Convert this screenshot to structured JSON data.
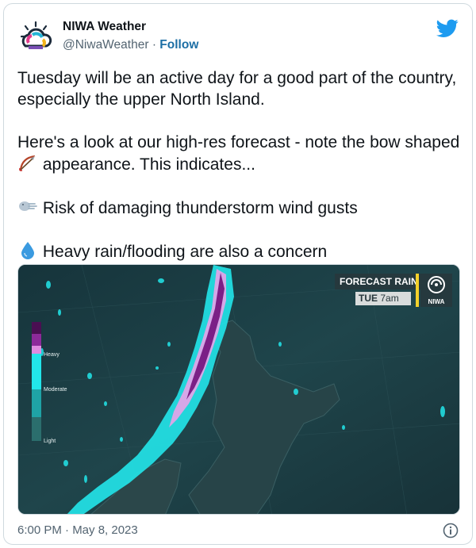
{
  "account": {
    "display_name": "NIWA Weather",
    "handle": "@NiwaWeather",
    "separator": "·",
    "follow_label": "Follow"
  },
  "tweet": {
    "line1": "Tuesday will be an active day for a good part of the country, especially the upper North Island.",
    "line2_before_emoji": "Here's a look at our high-res forecast - note the bow shaped",
    "line2_after_emoji": "appearance. This indicates...",
    "line3": "Risk of damaging thunderstorm wind gusts",
    "line4": "Heavy rain/flooding are also a concern"
  },
  "media": {
    "title": "FORECAST RAIN",
    "day": "TUE",
    "time": "7am",
    "logo_text": "NIWA",
    "legend": {
      "heavy": "Heavy",
      "moderate": "Moderate",
      "light": "Light"
    }
  },
  "footer": {
    "timestamp": "6:00 PM · May 8, 2023"
  },
  "icons": {
    "twitter": "twitter-bird-icon",
    "bow": "bow-and-arrow-icon",
    "wind": "wind-face-icon",
    "droplet": "droplet-icon",
    "info": "info-icon"
  },
  "colors": {
    "follow": "#1d6fa5",
    "twitter_blue": "#1d9bf0",
    "text": "#0f1419",
    "muted": "#536471"
  }
}
